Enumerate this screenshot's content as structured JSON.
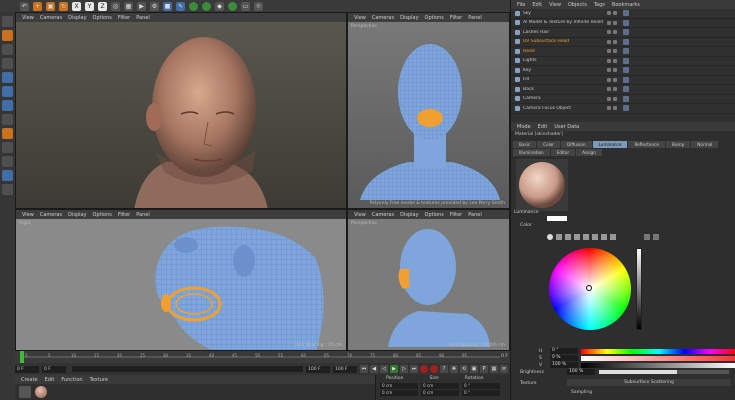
{
  "toolbar": {
    "icons": [
      "undo-icon",
      "redo-icon",
      "move-icon",
      "scale-icon",
      "rotate-icon",
      "x-axis",
      "y-axis",
      "z-axis",
      "coord-icon",
      "render-region",
      "render-view",
      "render-settings",
      "cube-icon",
      "pen-icon",
      "subdiv-icon",
      "cloner-icon",
      "deformer-icon",
      "scene-icon",
      "camera-icon",
      "light-icon"
    ],
    "axis_x": "X",
    "axis_y": "Y",
    "axis_z": "Z"
  },
  "viewports": {
    "top_left": {
      "menu": [
        "View",
        "Cameras",
        "Display",
        "Options",
        "Filter",
        "Panel"
      ]
    },
    "top_right": {
      "menu": [
        "View",
        "Cameras",
        "Display",
        "Options",
        "Filter",
        "Panel"
      ],
      "label": "Perspective",
      "footer": "Polyonly Free model & textures provided by Lee Perry-Smith"
    },
    "bottom_left": {
      "menu": [
        "View",
        "Cameras",
        "Display",
        "Options",
        "Filter",
        "Panel"
      ],
      "label": "Right",
      "footer": "Grid Spacing : 10 cm"
    },
    "bottom_right": {
      "menu": [
        "View",
        "Cameras",
        "Display",
        "Options",
        "Filter",
        "Panel"
      ],
      "label": "Perspective",
      "footer": "Grid Spacing : 10000 cm"
    }
  },
  "object_manager": {
    "menu": [
      "File",
      "Edit",
      "View",
      "Objects",
      "Tags",
      "Bookmarks"
    ],
    "rows": [
      {
        "name": "Sky"
      },
      {
        "name": "Al Model & Texture by Infinite Realities"
      },
      {
        "name": "Lashes Hair"
      },
      {
        "name": "UV Subsurface Head",
        "highlight": true
      },
      {
        "name": "Head",
        "highlight": true
      },
      {
        "name": "Lights"
      },
      {
        "name": "Key"
      },
      {
        "name": "Fill"
      },
      {
        "name": "Back"
      },
      {
        "name": "Camera"
      },
      {
        "name": "Camera Focus Object"
      }
    ]
  },
  "attribute_manager": {
    "menu": [
      "Mode",
      "Edit",
      "User Data"
    ],
    "title": "Material [skinshader]",
    "tabs": [
      "Basic",
      "Color",
      "Diffusion",
      "Luminance",
      "Reflectance",
      "Bump",
      "Normal",
      "Illumination",
      "Editor",
      "Assign"
    ],
    "active_tab": "Luminance",
    "section": "Luminance",
    "color_label": "Color",
    "sliders": [
      {
        "label": "H",
        "value": "0 °",
        "gradient": "linear-gradient(90deg,#ff0000,#ffff00,#00ff00,#00ffff,#0000ff,#ff00ff,#ff0000)"
      },
      {
        "label": "S",
        "value": "0 %",
        "gradient": "linear-gradient(90deg,#ffffff,#ff3030)"
      },
      {
        "label": "V",
        "value": "100 %",
        "gradient": "linear-gradient(90deg,#000000,#ffffff)"
      }
    ],
    "brightness_label": "Brightness",
    "brightness_value": "100 %",
    "texture_label": "Texture",
    "subsurface_label": "Subsurface Scattering",
    "sampling_label": "Sampling"
  },
  "timeline": {
    "ticks": [
      "0",
      "5",
      "10",
      "15",
      "20",
      "25",
      "30",
      "35",
      "40",
      "45",
      "50",
      "55",
      "60",
      "65",
      "70",
      "75",
      "80",
      "85",
      "90",
      "95"
    ],
    "end_label": "0 F",
    "start_frame": "0 F",
    "current_frame": "0 F",
    "end_frame": "100 F",
    "max_frame": "100 F"
  },
  "material_manager": {
    "menu": [
      "Create",
      "Edit",
      "Function",
      "Texture"
    ]
  },
  "coordinates": {
    "headers": [
      "Position",
      "Size",
      "Rotation"
    ],
    "x": [
      "0 cm",
      "0 cm",
      "0 °"
    ],
    "y": [
      "0 cm",
      "0 cm",
      "0 °"
    ],
    "z": [
      "0 cm",
      "0 cm",
      "0 °"
    ]
  },
  "colors": {
    "wireframe_blue": "#7fa6dc",
    "highlight_orange": "#f0a030",
    "accent_blue": "#3f6ea8"
  }
}
